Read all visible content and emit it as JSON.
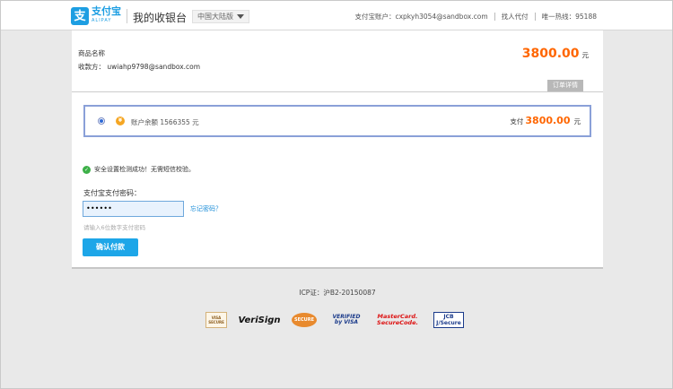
{
  "header": {
    "logo_text": "支付宝",
    "logo_sub": "ALIPAY",
    "title": "我的收银台",
    "region": "中国大陆版",
    "account_label": "支付宝账户：cxpkyh3054@sandbox.com",
    "agent_pay": "找人代付",
    "hotline": "唯一热线：95188"
  },
  "order": {
    "name_label": "商品名称",
    "payee_label": "收款方：",
    "payee": "uwiahp9798@sandbox.com",
    "amount": "3800.00",
    "unit": "元",
    "detail_button": "订单详情"
  },
  "payment": {
    "method": "账户余额 1566355 元",
    "pay_label": "支付",
    "amount": "3800.00",
    "unit": "元"
  },
  "security": {
    "message": "安全设置检测成功！无需短信校验。"
  },
  "password": {
    "label": "支付宝支付密码：",
    "value": "••••••",
    "forgot": "忘记密码？",
    "hint": "请输入6位数字支付密码",
    "confirm": "确认付款"
  },
  "footer": {
    "icp": "ICP证：沪B2-20150087",
    "badges": {
      "visa_sec": "VISA SECURE",
      "verisign": "VeriSign",
      "cert": "SECURE",
      "vbv_1": "VERIFIED",
      "vbv_2": "by VISA",
      "mc_1": "MasterCard.",
      "mc_2": "SecureCode.",
      "jcb_1": "JCB",
      "jcb_2": "J/Secure"
    }
  },
  "colors": {
    "brand": "#1d9ee2",
    "amount": "#ff6600",
    "button": "#1da6e8",
    "success": "#3db048"
  }
}
